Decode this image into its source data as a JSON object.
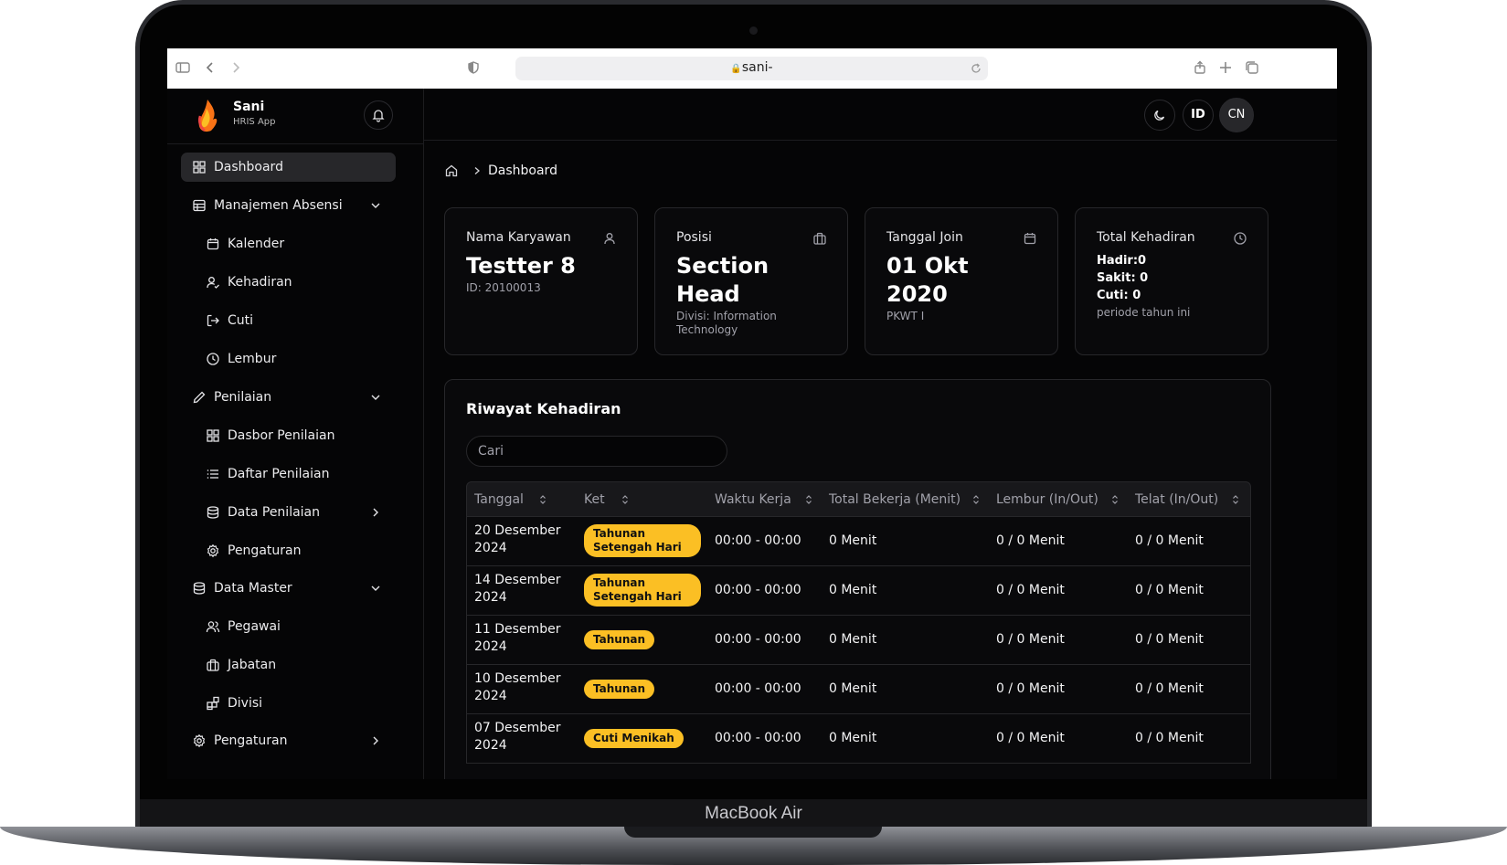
{
  "device": {
    "brand": "MacBook Air"
  },
  "browser": {
    "url": "sani-"
  },
  "app": {
    "name": "Sani",
    "subtitle": "HRIS App"
  },
  "sidebar": {
    "items": [
      {
        "label": "Dashboard",
        "icon": "layout-grid-icon",
        "level": 0,
        "active": true
      },
      {
        "label": "Manajemen Absensi",
        "icon": "table-icon",
        "level": 0,
        "expanded": true
      },
      {
        "label": "Kalender",
        "icon": "calendar-icon",
        "level": 1
      },
      {
        "label": "Kehadiran",
        "icon": "user-check-icon",
        "level": 1
      },
      {
        "label": "Cuti",
        "icon": "log-out-icon",
        "level": 1
      },
      {
        "label": "Lembur",
        "icon": "clock-icon",
        "level": 1
      },
      {
        "label": "Penilaian",
        "icon": "pencil-icon",
        "level": 0,
        "expanded": true
      },
      {
        "label": "Dasbor Penilaian",
        "icon": "layout-grid-icon",
        "level": 1
      },
      {
        "label": "Daftar Penilaian",
        "icon": "list-icon",
        "level": 1
      },
      {
        "label": "Data Penilaian",
        "icon": "database-icon",
        "level": 1,
        "collapsed": true
      },
      {
        "label": "Pengaturan",
        "icon": "settings-icon",
        "level": 1
      },
      {
        "label": "Data Master",
        "icon": "database-icon",
        "level": 0,
        "expanded": true
      },
      {
        "label": "Pegawai",
        "icon": "users-icon",
        "level": 1
      },
      {
        "label": "Jabatan",
        "icon": "briefcase-icon",
        "level": 1
      },
      {
        "label": "Divisi",
        "icon": "blocks-icon",
        "level": 1
      },
      {
        "label": "Pengaturan",
        "icon": "settings-icon",
        "level": 0,
        "collapsed": true
      }
    ]
  },
  "topbar": {
    "lang": "ID",
    "avatar": "CN"
  },
  "breadcrumb": {
    "current": "Dashboard"
  },
  "cards": {
    "employee": {
      "label": "Nama Karyawan",
      "value": "Testter 8",
      "sub": "ID: 20100013"
    },
    "position": {
      "label": "Posisi",
      "value": "Section Head",
      "sub": "Divisi: Information Technology"
    },
    "join": {
      "label": "Tanggal Join",
      "value": "01 Okt 2020",
      "sub": "PKWT I"
    },
    "attendance": {
      "label": "Total Kehadiran",
      "hadir": "Hadir:0",
      "sakit": "Sakit: 0",
      "cuti": "Cuti: 0",
      "sub": "periode tahun ini"
    }
  },
  "history": {
    "title": "Riwayat Kehadiran",
    "search_placeholder": "Cari",
    "columns": [
      "Tanggal",
      "Ket",
      "Waktu Kerja",
      "Total Bekerja (Menit)",
      "Lembur (In/Out)",
      "Telat (In/Out)"
    ],
    "rows": [
      {
        "date": "20 Desember 2024",
        "ket": "Tahunan Setengah Hari",
        "work": "00:00 - 00:00",
        "total": "0 Menit",
        "lembur": "0 / 0 Menit",
        "telat": "0 / 0 Menit"
      },
      {
        "date": "14 Desember 2024",
        "ket": "Tahunan Setengah Hari",
        "work": "00:00 - 00:00",
        "total": "0 Menit",
        "lembur": "0 / 0 Menit",
        "telat": "0 / 0 Menit"
      },
      {
        "date": "11 Desember 2024",
        "ket": "Tahunan",
        "work": "00:00 - 00:00",
        "total": "0 Menit",
        "lembur": "0 / 0 Menit",
        "telat": "0 / 0 Menit"
      },
      {
        "date": "10 Desember 2024",
        "ket": "Tahunan",
        "work": "00:00 - 00:00",
        "total": "0 Menit",
        "lembur": "0 / 0 Menit",
        "telat": "0 / 0 Menit"
      },
      {
        "date": "07 Desember 2024",
        "ket": "Cuti Menikah",
        "work": "00:00 - 00:00",
        "total": "0 Menit",
        "lembur": "0 / 0 Menit",
        "telat": "0 / 0 Menit"
      }
    ]
  },
  "colors": {
    "badge": "#fbbf24",
    "background": "#050506",
    "card": "#09090b",
    "border": "#27272a"
  }
}
